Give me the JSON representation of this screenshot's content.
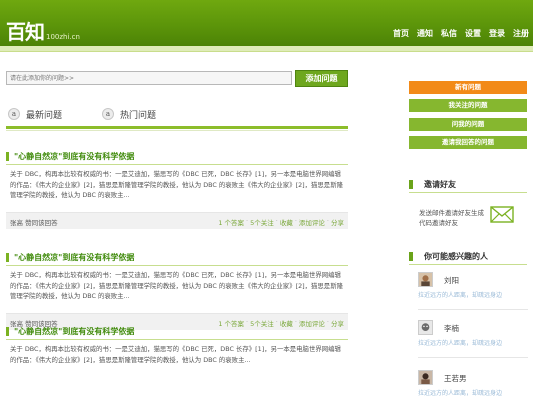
{
  "header": {
    "logo": "百知",
    "domain": "100zhi.cn",
    "nav": [
      "首页",
      "通知",
      "私信",
      "设置",
      "登录",
      "注册"
    ]
  },
  "search": {
    "placeholder": "请在此添加你的问题>>",
    "add_button": "添加问题"
  },
  "tabs": [
    {
      "label": "最新问题",
      "icon": "a-circle-icon"
    },
    {
      "label": "热门问题",
      "icon": "a-circle-icon"
    }
  ],
  "questions": [
    {
      "title": "\"心静自然凉\"到底有没有科学依据",
      "body": "关于 DBC，构再本比较有权威的书：一是艾迪加，猫思写的《DBC 已死，DBC 长存》[1]，另一本是电脑世界网编辑的作品：《伟大的企业家》[2]，猫思是斯隆管理学院的教授，他认为 DBC 的衰败主《伟大的企业家》[2]，猫思是斯隆管理学院的教授，他认为 DBC 的衰败主...",
      "author": "张高",
      "action": "赞同该回答",
      "meta": [
        "1 个答案",
        "5个关注",
        "收藏",
        "添加评论",
        "分享"
      ]
    },
    {
      "title": "\"心静自然凉\"到底有没有科学依据",
      "body": "关于 DBC，构再本比较有权威的书：一是艾迪加，猫思写的《DBC 已死，DBC 长存》[1]，另一本是电脑世界网编辑的作品：《伟大的企业家》[2]，猫思是斯隆管理学院的教授，他认为 DBC 的衰败主《伟大的企业家》[2]，猫思是斯隆管理学院的教授，他认为 DBC 的衰败主...",
      "author": "张高",
      "action": "赞同该回答",
      "meta": [
        "1 个答案",
        "5个关注",
        "收藏",
        "添加评论",
        "分享"
      ]
    },
    {
      "title": "\"心静自然凉\"到底有没有科学依据",
      "body": "关于 DBC，构再本比较有权威的书：一是艾迪加，猫思写的《DBC 已死，DBC 长存》[1]，另一本是电脑世界网编辑的作品：《伟大的企业家》[2]，猫思是斯隆管理学院的教授，他认为 DBC 的衰败主...",
      "author": "",
      "action": "",
      "meta": []
    }
  ],
  "sidebar": {
    "buttons": [
      {
        "label": "新有问题",
        "color": "#f28a18"
      },
      {
        "label": "我关注的问题",
        "color": "#86b72f"
      },
      {
        "label": "问我的问题",
        "color": "#86b72f"
      },
      {
        "label": "邀请我回答的问题",
        "color": "#86b72f"
      }
    ],
    "invite": {
      "title": "邀请好友",
      "text": "发送邮件邀请好友生成代码邀请好友",
      "icon": "mail-icon"
    },
    "people": {
      "title": "你可能感兴趣的人",
      "list": [
        {
          "name": "刘阳",
          "desc": "拉近远方的人距离，却疏远身边"
        },
        {
          "name": "李楠",
          "desc": "拉近远方的人距离，却疏远身边"
        },
        {
          "name": "王若男",
          "desc": "拉近远方的人距离，却疏远身边"
        }
      ]
    }
  },
  "colors": {
    "brand_green": "#5c950a",
    "accent_orange": "#f28a18",
    "title_green": "#3f8a0a",
    "link_blue": "#97b8d6"
  }
}
